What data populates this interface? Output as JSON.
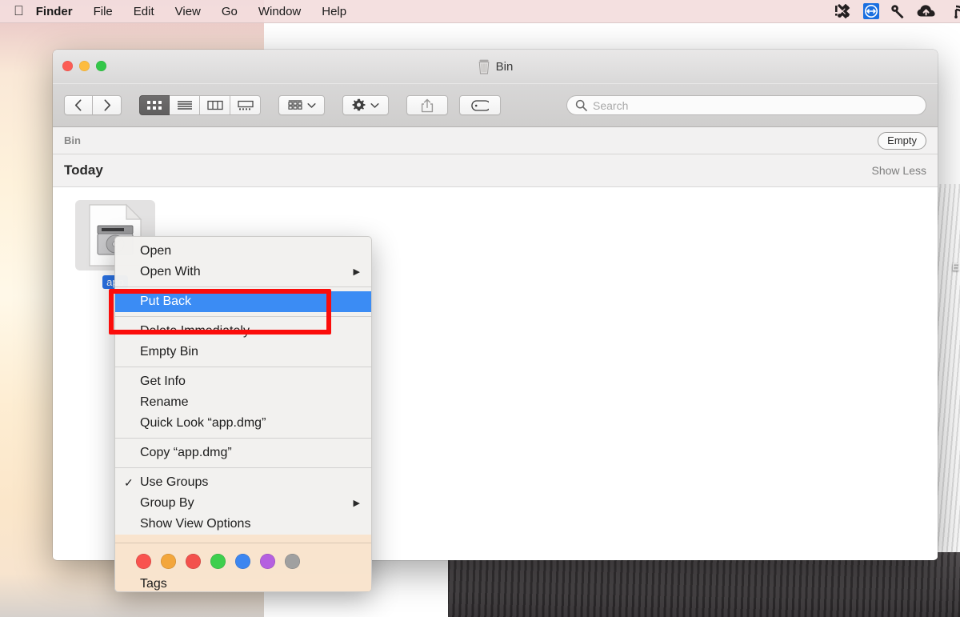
{
  "menubar": {
    "apple_icon": "apple-logo-icon",
    "items": [
      {
        "label": "Finder",
        "bold": true
      },
      {
        "label": "File",
        "bold": false
      },
      {
        "label": "Edit",
        "bold": false
      },
      {
        "label": "View",
        "bold": false
      },
      {
        "label": "Go",
        "bold": false
      },
      {
        "label": "Window",
        "bold": false
      },
      {
        "label": "Help",
        "bold": false
      }
    ],
    "status_icons": [
      {
        "name": "network-alert-icon"
      },
      {
        "name": "teamviewer-icon",
        "color": "#1a6fe0"
      },
      {
        "name": "key-icon"
      },
      {
        "name": "cloud-upload-icon"
      },
      {
        "name": "wifi-icon"
      }
    ]
  },
  "window": {
    "title": "Bin",
    "title_icon": "trash-bin-icon",
    "traffic_lights": [
      "close",
      "minimize",
      "zoom"
    ],
    "toolbar": {
      "back_label": "Back",
      "forward_label": "Forward",
      "view_modes": [
        {
          "name": "icon-view",
          "selected": true
        },
        {
          "name": "list-view",
          "selected": false
        },
        {
          "name": "column-view",
          "selected": false
        },
        {
          "name": "gallery-view",
          "selected": false
        }
      ],
      "arrange_label": "Arrange",
      "action_label": "Action",
      "share_label": "Share",
      "tags_label": "Tags",
      "search": {
        "placeholder": "Search",
        "value": ""
      }
    },
    "pathbar": {
      "label": "Bin",
      "empty_button": "Empty"
    },
    "group": {
      "title": "Today",
      "show_less": "Show Less"
    },
    "files": [
      {
        "name": "app",
        "full_name": "app.dmg",
        "icon": "disk-image-icon",
        "selected": true
      }
    ]
  },
  "context_menu": {
    "sections": [
      {
        "items": [
          {
            "label": "Open",
            "submenu": false,
            "checked": false,
            "selected": false
          },
          {
            "label": "Open With",
            "submenu": true,
            "checked": false,
            "selected": false
          }
        ]
      },
      {
        "items": [
          {
            "label": "Put Back",
            "submenu": false,
            "checked": false,
            "selected": true
          }
        ]
      },
      {
        "items": [
          {
            "label": "Delete Immediately…",
            "submenu": false,
            "checked": false,
            "selected": false
          },
          {
            "label": "Empty Bin",
            "submenu": false,
            "checked": false,
            "selected": false
          }
        ]
      },
      {
        "items": [
          {
            "label": "Get Info",
            "submenu": false,
            "checked": false,
            "selected": false
          },
          {
            "label": "Rename",
            "submenu": false,
            "checked": false,
            "selected": false
          },
          {
            "label": "Quick Look “app.dmg”",
            "submenu": false,
            "checked": false,
            "selected": false
          }
        ]
      },
      {
        "items": [
          {
            "label": "Copy “app.dmg”",
            "submenu": false,
            "checked": false,
            "selected": false
          }
        ]
      },
      {
        "items": [
          {
            "label": "Use Groups",
            "submenu": false,
            "checked": true,
            "selected": false
          },
          {
            "label": "Group By",
            "submenu": true,
            "checked": false,
            "selected": false
          },
          {
            "label": "Show View Options",
            "submenu": false,
            "checked": false,
            "selected": false
          }
        ]
      }
    ],
    "tags": {
      "label": "Tags",
      "colors": [
        "#f9534e",
        "#f3a63c",
        "#f3514c",
        "#3ecf4d",
        "#3d86f0",
        "#b560e0",
        "#a0a0a0"
      ]
    },
    "highlight_color": "#3b8cf4"
  },
  "annotation": {
    "target": "Put Back",
    "color": "#fb0d0b"
  },
  "desktop": {
    "partial_label": "E"
  }
}
